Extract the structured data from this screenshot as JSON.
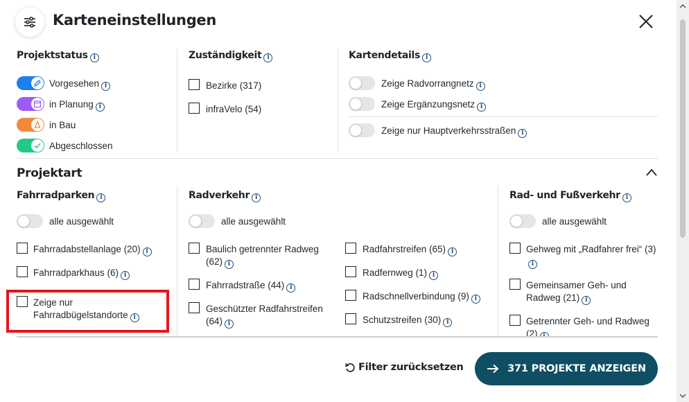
{
  "header": {
    "title": "Karteneinstellungen"
  },
  "projektstatus": {
    "heading": "Projektstatus",
    "items": [
      {
        "label": "Vorgesehen",
        "color": "#1b7ff0"
      },
      {
        "label": "in Planung",
        "color": "#9b5cf0"
      },
      {
        "label": "in Bau",
        "color": "#f28a3c"
      },
      {
        "label": "Abgeschlossen",
        "color": "#22c98a"
      }
    ]
  },
  "zustaendigkeit": {
    "heading": "Zuständigkeit",
    "items": [
      {
        "label": "Bezirke (317)"
      },
      {
        "label": "infraVelo (54)"
      }
    ]
  },
  "kartendetails": {
    "heading": "Kartendetails",
    "items": [
      {
        "label": "Zeige Radvorrangnetz"
      },
      {
        "label": "Zeige Ergänzungsnetz"
      },
      {
        "label": "Zeige nur Hauptverkehrsstraßen"
      }
    ]
  },
  "projektart": {
    "heading": "Projektart",
    "fahrradparken": {
      "heading": "Fahrradparken",
      "all_label": "alle ausgewählt",
      "items": [
        {
          "label": "Fahrradabstellanlage (20)"
        },
        {
          "label": "Fahrradparkhaus (6)"
        },
        {
          "label": "Zeige nur Fahrradbügelstandorte"
        }
      ]
    },
    "radverkehr": {
      "heading": "Radverkehr",
      "all_label": "alle ausgewählt",
      "items": [
        {
          "label": "Baulich getrennter Radweg (62)"
        },
        {
          "label": "Fahrradstraße (44)"
        },
        {
          "label": "Geschützter Radfahrstreifen (64)"
        },
        {
          "label": "Radfahrstreifen (65)"
        },
        {
          "label": "Radfernweg (1)"
        },
        {
          "label": "Radschnellverbindung (9)"
        },
        {
          "label": "Schutzstreifen (30)"
        }
      ]
    },
    "rad_fuss": {
      "heading": "Rad- und Fußverkehr",
      "all_label": "alle ausgewählt",
      "items": [
        {
          "label": "Gehweg mit „Radfahrer frei“ (3)"
        },
        {
          "label": "Gemeinsamer Geh- und Radweg (21)"
        },
        {
          "label": "Getrennter Geh- und Radweg (2)"
        }
      ]
    }
  },
  "footer": {
    "reset_label": "Filter zurücksetzen",
    "show_label": "371 PROJEKTE ANZEIGEN"
  },
  "colors": {
    "primary": "#0f4e63",
    "highlight": "#e3161e"
  }
}
